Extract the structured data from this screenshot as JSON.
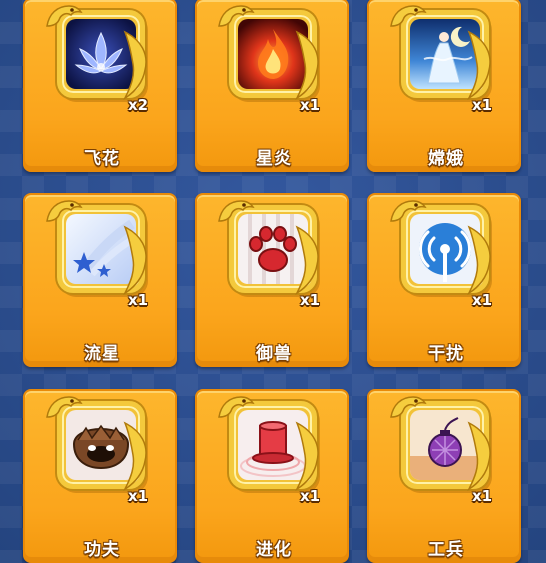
{
  "items": [
    {
      "name": "飞花",
      "count": "x2",
      "icon": "blue-lotus-icon"
    },
    {
      "name": "星炎",
      "count": "x1",
      "icon": "fire-flame-icon"
    },
    {
      "name": "嫦娥",
      "count": "x1",
      "icon": "moon-fairy-icon"
    },
    {
      "name": "流星",
      "count": "x1",
      "icon": "shooting-star-icon"
    },
    {
      "name": "御兽",
      "count": "x1",
      "icon": "paw-print-icon"
    },
    {
      "name": "干扰",
      "count": "x1",
      "icon": "signal-tower-icon"
    },
    {
      "name": "功夫",
      "count": "x1",
      "icon": "kungfu-face-icon"
    },
    {
      "name": "进化",
      "count": "x1",
      "icon": "red-hat-icon"
    },
    {
      "name": "工兵",
      "count": "x1",
      "icon": "bomb-icon"
    }
  ],
  "colors": {
    "background": "#2c4d93",
    "card": "#fcad22",
    "frame_gold": "#f4c93c",
    "text_outline": "#7a3e00"
  }
}
